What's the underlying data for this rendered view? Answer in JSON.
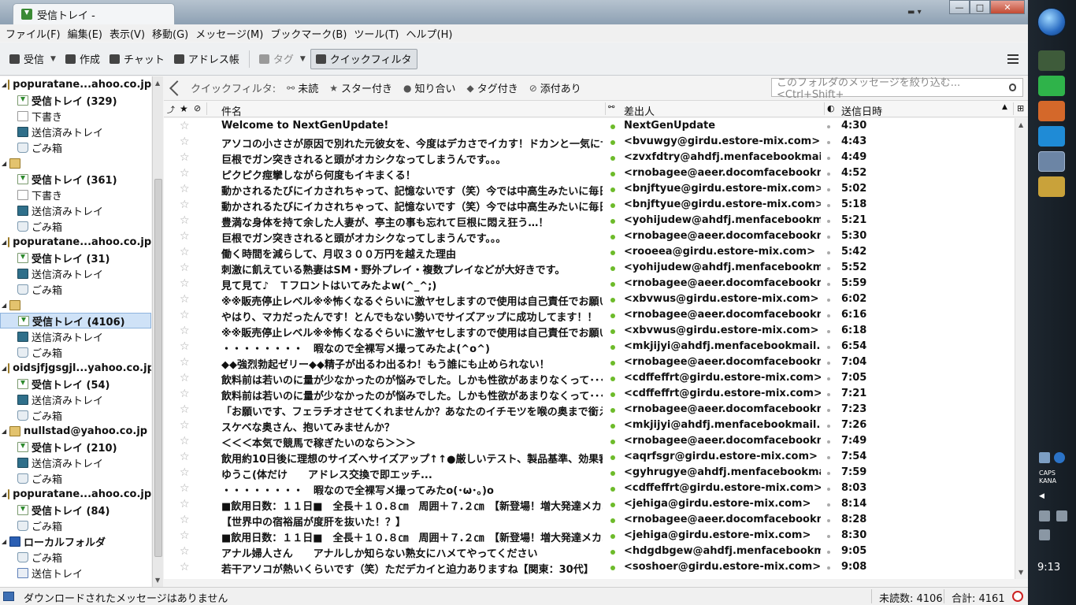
{
  "window": {
    "tab_title": "受信トレイ -",
    "controls": {
      "minimize": "—",
      "maximize": "□",
      "close": "✕"
    }
  },
  "menu": [
    "ファイル(F)",
    "編集(E)",
    "表示(V)",
    "移動(G)",
    "メッセージ(M)",
    "ブックマーク(B)",
    "ツール(T)",
    "ヘルプ(H)"
  ],
  "toolbar": {
    "get_mail": "受信",
    "write": "作成",
    "chat": "チャット",
    "address_book": "アドレス帳",
    "tag": "タグ",
    "quick_filter": "クイックフィルタ"
  },
  "quick_filter_bar": {
    "label": "クイックフィルタ:",
    "unread": "未読",
    "starred": "スター付き",
    "contacts": "知り合い",
    "tags": "タグ付き",
    "attachment": "添付あり",
    "search_placeholder": "このフォルダのメッセージを絞り込む... <Ctrl+Shift+"
  },
  "folder_pane": [
    {
      "type": "acct",
      "label": "popuratane...ahoo.co.jp"
    },
    {
      "type": "inbox",
      "label": "受信トレイ (329)",
      "bold": true
    },
    {
      "type": "draft",
      "label": "下書き"
    },
    {
      "type": "sent",
      "label": "送信済みトレイ"
    },
    {
      "type": "trash",
      "label": "ごみ箱"
    },
    {
      "type": "acct",
      "label": ""
    },
    {
      "type": "inbox",
      "label": "受信トレイ (361)",
      "bold": true
    },
    {
      "type": "draft",
      "label": "下書き"
    },
    {
      "type": "sent",
      "label": "送信済みトレイ"
    },
    {
      "type": "trash",
      "label": "ごみ箱"
    },
    {
      "type": "acct",
      "label": "popuratane...ahoo.co.jp"
    },
    {
      "type": "inbox",
      "label": "受信トレイ (31)",
      "bold": true
    },
    {
      "type": "sent",
      "label": "送信済みトレイ"
    },
    {
      "type": "trash",
      "label": "ごみ箱"
    },
    {
      "type": "acct",
      "label": ""
    },
    {
      "type": "inbox",
      "label": "受信トレイ (4106)",
      "bold": true,
      "selected": true
    },
    {
      "type": "sent",
      "label": "送信済みトレイ"
    },
    {
      "type": "trash",
      "label": "ごみ箱"
    },
    {
      "type": "acct",
      "label": "oidsjfjgsgjl...yahoo.co.jp"
    },
    {
      "type": "inbox",
      "label": "受信トレイ (54)",
      "bold": true
    },
    {
      "type": "sent",
      "label": "送信済みトレイ"
    },
    {
      "type": "trash",
      "label": "ごみ箱"
    },
    {
      "type": "acct",
      "label": "nullstad@yahoo.co.jp"
    },
    {
      "type": "inbox",
      "label": "受信トレイ (210)",
      "bold": true
    },
    {
      "type": "sent",
      "label": "送信済みトレイ"
    },
    {
      "type": "trash",
      "label": "ごみ箱"
    },
    {
      "type": "acct",
      "label": "popuratane...ahoo.co.jp"
    },
    {
      "type": "inbox",
      "label": "受信トレイ (84)",
      "bold": true
    },
    {
      "type": "trash",
      "label": "ごみ箱"
    },
    {
      "type": "local",
      "label": "ローカルフォルダ"
    },
    {
      "type": "trash",
      "label": "ごみ箱"
    },
    {
      "type": "outbox",
      "label": "送信トレイ"
    }
  ],
  "columns": {
    "subject": "件名",
    "sender": "差出人",
    "date": "送信日時"
  },
  "messages": [
    {
      "subject": "Welcome to NextGenUpdate!",
      "from": "NextGenUpdate",
      "date": "4:30"
    },
    {
      "subject": "アソコの小ささが原因で別れた元彼女を、今度はデカさでイカす！ドカンと一気にサイ...",
      "from": "<bvuwgy@girdu.estore-mix.com>",
      "date": "4:43"
    },
    {
      "subject": "巨根でガン突きされると頭がオカシクなってしまうんです。。。",
      "from": "<zvxfdtry@ahdfj.menfacebookmail.c...",
      "date": "4:49"
    },
    {
      "subject": "ピクピク痙攣しながら何度もイキまくる！",
      "from": "<rnobagee@aeer.docomfacebookma...",
      "date": "4:52"
    },
    {
      "subject": "動かされるたびにイカされちゃって、記憶ないです（笑）今では中高生みたいに毎日セ...",
      "from": "<bnjftyue@girdu.estore-mix.com>",
      "date": "5:02"
    },
    {
      "subject": "動かされるたびにイカされちゃって、記憶ないです（笑）今では中高生みたいに毎日セ...",
      "from": "<bnjftyue@girdu.estore-mix.com>",
      "date": "5:18"
    },
    {
      "subject": "豊満な身体を持て余した人妻が、亭主の事も忘れて巨根に悶え狂う…！",
      "from": "<yohijudew@ahdfj.menfacebookmail....",
      "date": "5:21"
    },
    {
      "subject": "巨根でガン突きされると頭がオカシクなってしまうんです。。。",
      "from": "<rnobagee@aeer.docomfacebookma...",
      "date": "5:30"
    },
    {
      "subject": "働く時間を減らして、月収３００万円を越えた理由",
      "from": "<rooeea@girdu.estore-mix.com>",
      "date": "5:42"
    },
    {
      "subject": "刺激に飢えている熟妻はSM・野外プレイ・複数プレイなどが大好きです。",
      "from": "<yohijudew@ahdfj.menfacebookmail....",
      "date": "5:52"
    },
    {
      "subject": "見て見て♪　Ｔフロントはいてみたよw(^_^;)",
      "from": "<rnobagee@aeer.docomfacebookma...",
      "date": "5:59"
    },
    {
      "subject": "※※販売停止レベル※※怖くなるぐらいに激ヤセしますので使用は自己責任でお願いし...",
      "from": "<xbvwus@girdu.estore-mix.com>",
      "date": "6:02"
    },
    {
      "subject": "やはり、マカだったんです！とんでもない勢いでサイズアップに成功してます！！",
      "from": "<rnobagee@aeer.docomfacebookma...",
      "date": "6:16"
    },
    {
      "subject": "※※販売停止レベル※※怖くなるぐらいに激ヤセしますので使用は自己責任でお願いし...",
      "from": "<xbvwus@girdu.estore-mix.com>",
      "date": "6:18"
    },
    {
      "subject": "・・・・・・・・　暇なので全裸写メ撮ってみたよ(^o^)",
      "from": "<mkjijyi@ahdfj.menfacebookmail.co...",
      "date": "6:54"
    },
    {
      "subject": "◆◆強烈勃起ゼリー◆◆精子が出るわ出るわ！もう誰にも止められない！",
      "from": "<rnobagee@aeer.docomfacebookma...",
      "date": "7:04"
    },
    {
      "subject": "飲料前は若いのに量が少なかったのが悩みでした。しかも性欲があまりなくって･･･とこ...",
      "from": "<cdffeffrt@girdu.estore-mix.com>",
      "date": "7:05"
    },
    {
      "subject": "飲料前は若いのに量が少なかったのが悩みでした。しかも性欲があまりなくって･･･とこ...",
      "from": "<cdffeffrt@girdu.estore-mix.com>",
      "date": "7:21"
    },
    {
      "subject": "「お願いです、フェラチオさせてくれませんか？あなたのイチモツを喉の奥まで銜え込...",
      "from": "<rnobagee@aeer.docomfacebookma...",
      "date": "7:23"
    },
    {
      "subject": "スケベな奥さん、抱いてみませんか？",
      "from": "<mkjijyi@ahdfj.menfacebookmail.co...",
      "date": "7:26"
    },
    {
      "subject": "＜＜＜本気で競馬で稼ぎたいのなら＞＞＞",
      "from": "<rnobagee@aeer.docomfacebookma...",
      "date": "7:49"
    },
    {
      "subject": "飲用約10日後に理想のサイズへサイズアップ↑↑●厳しいテスト、製品基準、効果審査...",
      "from": "<aqrfsgr@girdu.estore-mix.com>",
      "date": "7:54"
    },
    {
      "subject": "ゆうこ(体だけ　　アドレス交換で即エッチ...",
      "from": "<gyhrugye@ahdfj.menfacebookmail....",
      "date": "7:59"
    },
    {
      "subject": "・・・・・・・・　暇なので全裸写メ撮ってみたo(･ω･｡)o",
      "from": "<cdffeffrt@girdu.estore-mix.com>",
      "date": "8:03"
    },
    {
      "subject": "■飲用日数：１１日■　全長＋１０.８㎝　周囲＋７.２㎝　【新登場！増大発達メカニ...",
      "from": "<jehiga@girdu.estore-mix.com>",
      "date": "8:14"
    },
    {
      "subject": "【世界中の宿裕届が度肝を抜いた！？】",
      "from": "<rnobagee@aeer.docomfacebookma...",
      "date": "8:28"
    },
    {
      "subject": "■飲用日数：１１日■　全長＋１０.８㎝　周囲＋７.２㎝　【新登場！増大発達メカニ...",
      "from": "<jehiga@girdu.estore-mix.com>",
      "date": "8:30"
    },
    {
      "subject": "アナル婦人さん　　アナルしか知らない熟女にハメてやってください",
      "from": "<hdgdbgew@ahdfj.menfacebookmail....",
      "date": "9:05"
    },
    {
      "subject": "若干アソコが熱いくらいです（笑）ただデカイと迫力ありますね【関東：30代】",
      "from": "<soshoer@girdu.estore-mix.com>",
      "date": "9:08"
    }
  ],
  "status": {
    "message": "ダウンロードされたメッセージはありません",
    "unread": "未読数: 4106",
    "total": "合計: 4161"
  },
  "taskbar": {
    "caps": "CAPS",
    "kana": "KANA",
    "clock": "9:13"
  }
}
